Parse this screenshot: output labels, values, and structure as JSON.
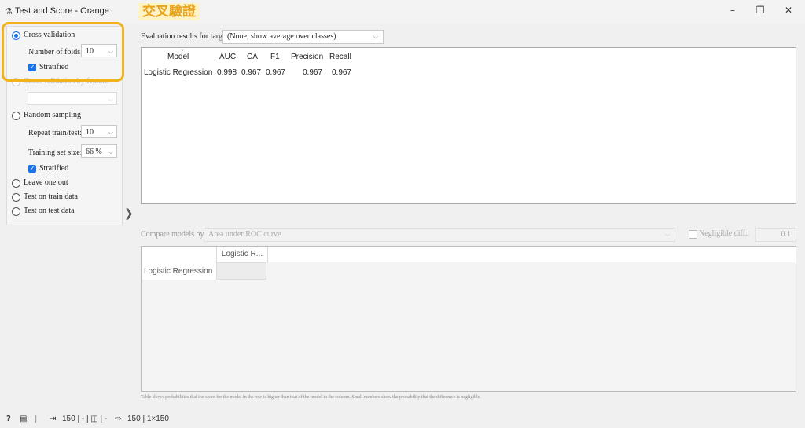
{
  "window": {
    "icon": "orange-flask-icon",
    "title": "Test and Score - Orange",
    "annotation": "交叉驗證",
    "minimize": "–",
    "restore": "❐",
    "close": "✕"
  },
  "sampling": {
    "cross_validation": "Cross validation",
    "folds_label": "Number of folds:",
    "folds_value": "10",
    "stratified_label": "Stratified",
    "cv_by_feature": "Cross validation by feature",
    "random_sampling": "Random sampling",
    "repeat_label": "Repeat train/test:",
    "repeat_value": "10",
    "train_size_label": "Training set size:",
    "train_size_value": "66 %",
    "stratified2_label": "Stratified",
    "leave_one_out": "Leave one out",
    "test_on_train": "Test on train data",
    "test_on_test": "Test on test data",
    "selected": "Cross validation"
  },
  "evaluation": {
    "target_label": "Evaluation results for target",
    "target_value": "(None, show average over classes)",
    "columns": [
      "Model",
      "AUC",
      "CA",
      "F1",
      "Precision",
      "Recall"
    ],
    "rows": [
      {
        "model": "Logistic Regression",
        "auc": "0.998",
        "ca": "0.967",
        "f1": "0.967",
        "precision": "0.967",
        "recall": "0.967"
      }
    ]
  },
  "comparison": {
    "label": "Compare models by:",
    "value": "Area under ROC curve",
    "negligible_label": "Negligible diff.:",
    "negligible_value": "0.1",
    "col_header": "Logistic R...",
    "row_header": "Logistic Regression",
    "footnote": "Table shows probabilities that the score for the model in the row is higher than that of the model in the column. Small numbers show the probability that the difference is negligible."
  },
  "status": {
    "help_icon": "help-icon",
    "report_icon": "report-icon",
    "input_summary": "150 | - | ◫ | -",
    "output_summary": "150 | 1×150"
  },
  "colors": {
    "accent": "#1a73e8",
    "highlight": "#f2b21a",
    "annotation_text": "#e8a21c",
    "annotation_bg": "#fdf3c6"
  }
}
